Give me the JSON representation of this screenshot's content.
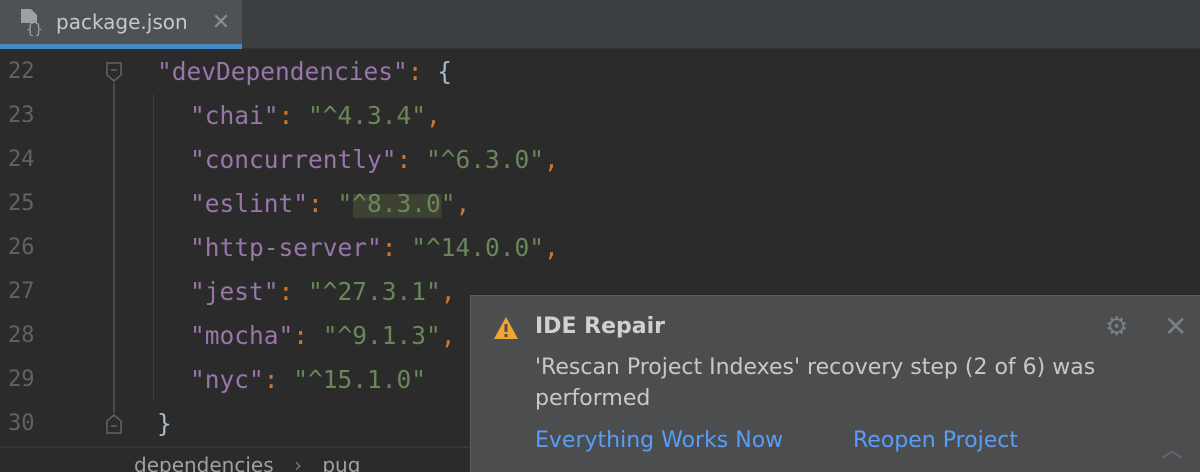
{
  "tab": {
    "label": "package.json",
    "icon": "json-file-icon"
  },
  "lines": [
    {
      "n": "22",
      "indent": 0,
      "key": "\"devDependencies\"",
      "colon": ": ",
      "val": "",
      "open": "{",
      "comma": ""
    },
    {
      "n": "23",
      "indent": 1,
      "key": "\"chai\"",
      "colon": ": ",
      "val": "\"^4.3.4\"",
      "comma": ","
    },
    {
      "n": "24",
      "indent": 1,
      "key": "\"concurrently\"",
      "colon": ": ",
      "val": "\"^6.3.0\"",
      "comma": ","
    },
    {
      "n": "25",
      "indent": 1,
      "key": "\"eslint\"",
      "colon": ": ",
      "val": "\"^8.3.0\"",
      "comma": ","
    },
    {
      "n": "26",
      "indent": 1,
      "key": "\"http-server\"",
      "colon": ": ",
      "val": "\"^14.0.0\"",
      "comma": ","
    },
    {
      "n": "27",
      "indent": 1,
      "key": "\"jest\"",
      "colon": ": ",
      "val": "\"^27.3.1\"",
      "comma": ","
    },
    {
      "n": "28",
      "indent": 1,
      "key": "\"mocha\"",
      "colon": ": ",
      "val": "\"^9.1.3\"",
      "comma": ","
    },
    {
      "n": "29",
      "indent": 1,
      "key": "\"nyc\"",
      "colon": ": ",
      "val": "\"^15.1.0\"",
      "comma": ""
    },
    {
      "n": "30",
      "indent": 0,
      "close": "}"
    }
  ],
  "breadcrumb": {
    "items": [
      "dependencies",
      "pug"
    ],
    "sep": "›"
  },
  "notification": {
    "title": "IDE Repair",
    "body": "'Rescan Project Indexes' recovery step (2 of 6) was performed",
    "actions": [
      "Everything Works Now",
      "Reopen Project"
    ]
  },
  "colors": {
    "accent": "#4a88c7",
    "link": "#589df6",
    "warning": "#f0a732"
  }
}
